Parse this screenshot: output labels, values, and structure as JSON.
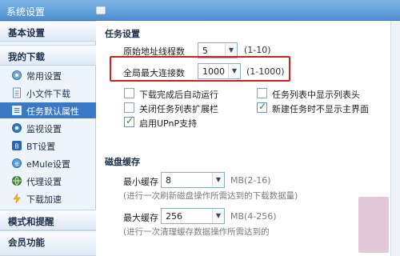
{
  "window": {
    "title": "系统设置"
  },
  "sidebar": {
    "sections": [
      {
        "label": "基本设置"
      },
      {
        "label": "我的下载"
      },
      {
        "label": "模式和提醒"
      },
      {
        "label": "会员功能"
      }
    ],
    "items": [
      {
        "label": "常用设置",
        "icon": "gear-icon"
      },
      {
        "label": "小文件下载",
        "icon": "file-icon"
      },
      {
        "label": "任务默认属性",
        "icon": "list-icon",
        "active": true
      },
      {
        "label": "监视设置",
        "icon": "monitor-icon"
      },
      {
        "label": "BT设置",
        "icon": "bt-icon"
      },
      {
        "label": "eMule设置",
        "icon": "emule-icon"
      },
      {
        "label": "代理设置",
        "icon": "proxy-icon"
      },
      {
        "label": "下载加速",
        "icon": "lightning-icon"
      }
    ]
  },
  "task": {
    "title": "任务设置",
    "threads": {
      "label": "原始地址线程数",
      "value": "5",
      "range": "(1-10)"
    },
    "max_conn": {
      "label": "全局最大连接数",
      "value": "1000",
      "range": "(1-1000)"
    },
    "checkboxes": {
      "auto_run": {
        "label": "下载完成后自动运行",
        "checked": false
      },
      "show_header": {
        "label": "任务列表中显示列表头",
        "checked": false
      },
      "close_expand": {
        "label": "关闭任务列表扩展栏",
        "checked": false
      },
      "new_no_main": {
        "label": "新建任务时不显示主界面",
        "checked": true
      },
      "upnp": {
        "label": "启用UPnP支持",
        "checked": true
      }
    }
  },
  "cache": {
    "title": "磁盘缓存",
    "min": {
      "label": "最小缓存",
      "value": "8",
      "unit": "MB(2-16)",
      "note": "(进行一次刷新磁盘操作所需达到的下载数据量)"
    },
    "max": {
      "label": "最大缓存",
      "value": "256",
      "unit": "MB(4-256)",
      "note": "(进行一次清理缓存数据操作所需达到的"
    }
  },
  "colors": {
    "highlight": "#cf1f1f",
    "active": "#3a79c6",
    "titlebar": "#4f8fd0"
  }
}
